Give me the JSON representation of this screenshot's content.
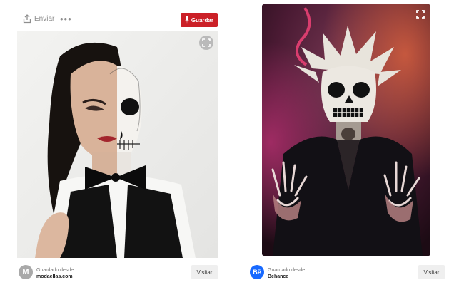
{
  "left_pin": {
    "share_label": "Enviar",
    "more_label": "•••",
    "save_label": "Guardar",
    "footer": {
      "avatar_letter": "M",
      "saved_from_label": "Guardado desde",
      "domain": "modaellas.com",
      "visit_label": "Visitar"
    }
  },
  "right_pin": {
    "footer": {
      "avatar_letter": "Bē",
      "saved_from_label": "Guardado desde",
      "domain": "Behance",
      "visit_label": "Visitar"
    }
  },
  "colors": {
    "save_button": "#cb2027",
    "behance_blue": "#1769ff",
    "avatar_gray": "#a9a9a9"
  },
  "icons": {
    "share": "share-icon",
    "save": "pin-icon",
    "expand": "expand-icon"
  }
}
